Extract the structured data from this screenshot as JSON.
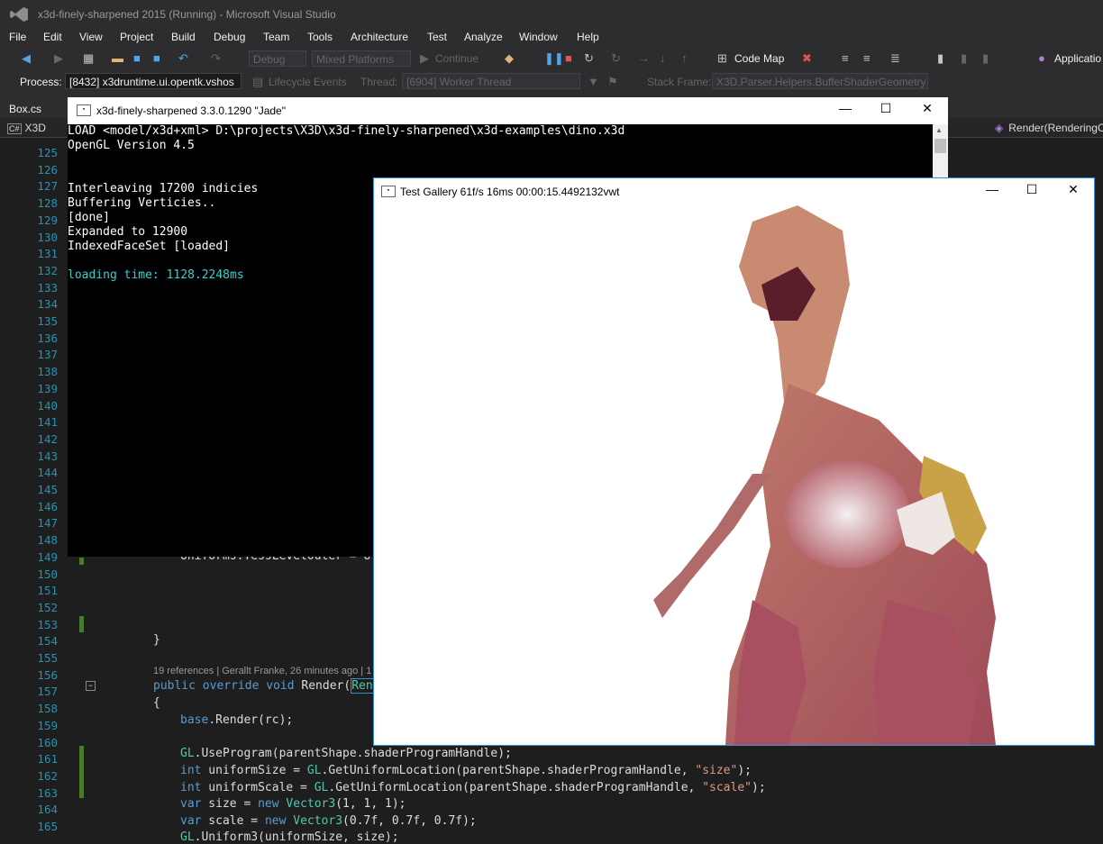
{
  "vs": {
    "title": "x3d-finely-sharpened 2015 (Running) - Microsoft Visual Studio",
    "menu": [
      "File",
      "Edit",
      "View",
      "Project",
      "Build",
      "Debug",
      "Team",
      "Tools",
      "Architecture",
      "Test",
      "Analyze",
      "Window",
      "Help"
    ],
    "toolbar": {
      "config": "Debug",
      "platform": "Mixed Platforms",
      "continue": "Continue",
      "code_map": "Code Map",
      "application": "Applicatio"
    },
    "toolbar2": {
      "process_label": "Process:",
      "process_value": "[8432] x3druntime.ui.opentk.vshos",
      "lifecycle": "Lifecycle Events",
      "thread_label": "Thread:",
      "thread_value": "[6904] Worker Thread",
      "stack_frame_label": "Stack Frame:",
      "stack_frame_value": "X3D.Parser.Helpers.BufferShaderGeometry"
    },
    "tab": {
      "file": "Box.cs"
    },
    "nav": {
      "project": "X3D",
      "method": "Render(RenderingC"
    }
  },
  "editor": {
    "line_numbers": [
      "125",
      "126",
      "127",
      "128",
      "129",
      "130",
      "131",
      "132",
      "133",
      "134",
      "135",
      "136",
      "137",
      "138",
      "139",
      "140",
      "141",
      "142",
      "143",
      "144",
      "145",
      "146",
      "147",
      "148",
      "149",
      "150",
      "151",
      "152",
      "153",
      "154",
      "155",
      "156",
      "157",
      "158",
      "159",
      "160",
      "161",
      "162",
      "163",
      "164",
      "165"
    ],
    "partial_149": "Uniforms.TessLevelOuter = U",
    "brace_154": "}",
    "codelens": "19 references | Gerallt Franke, 26 minutes ago | 1",
    "l156_public": "public",
    "l156_override": "override",
    "l156_void": "void",
    "l156_name": "Render(",
    "l156_param": "Ren",
    "l157": "{",
    "l158_base": "base",
    "l158_rest": ".Render(rc);",
    "l160_gl": "GL",
    "l160_rest": ".UseProgram(parentShape.shaderProgramHandle);",
    "l161_int": "int",
    "l161_var": " uniformSize = ",
    "l161_gl": "GL",
    "l161_call": ".GetUniformLocation(parentShape.shaderProgramHandle, ",
    "l161_str": "\"size\"",
    "l161_end": ");",
    "l162_int": "int",
    "l162_var": " uniformScale = ",
    "l162_gl": "GL",
    "l162_call": ".GetUniformLocation(parentShape.shaderProgramHandle, ",
    "l162_str": "\"scale\"",
    "l162_end": ");",
    "l163_var": "var",
    "l163_mid": " size = ",
    "l163_new": "new",
    "l163_type": "Vector3",
    "l163_args": "(1, 1, 1);",
    "l164_var": "var",
    "l164_mid": " scale = ",
    "l164_new": "new",
    "l164_type": "Vector3",
    "l164_args": "(0.7f, 0.7f, 0.7f);",
    "l165_gl": "GL",
    "l165_rest": ".Uniform3(uniformSize, size);"
  },
  "console": {
    "title": "x3d-finely-sharpened 3.3.0.1290 \"Jade\"",
    "lines": [
      "LOAD <model/x3d+xml> D:\\projects\\X3D\\x3d-finely-sharpened\\x3d-examples\\dino.x3d",
      "OpenGL Version 4.5",
      "",
      "",
      "Interleaving 17200 indicies",
      "Buffering Verticies..",
      "[done]",
      "Expanded to 12900",
      "IndexedFaceSet [loaded]"
    ],
    "cyan_line": "loading time: 1128.2248ms"
  },
  "gallery": {
    "title": "Test Gallery 61f/s 16ms 00:00:15.4492132vwt"
  },
  "colors": {
    "accent": "#3a8fd0",
    "line_number": "#2b91af",
    "keyword": "#569cd6",
    "type": "#4ec9b0",
    "string": "#d69d85"
  }
}
